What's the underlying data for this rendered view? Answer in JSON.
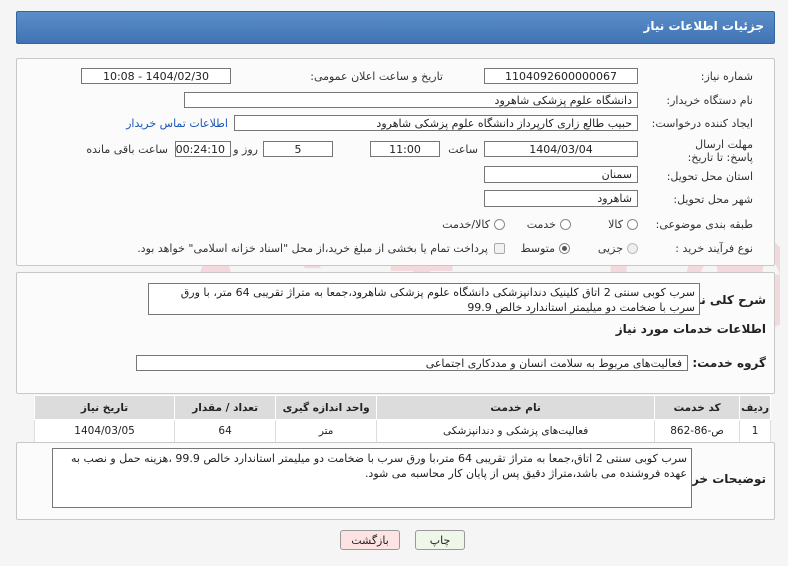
{
  "header": {
    "title": "جزئیات اطلاعات نیاز"
  },
  "form": {
    "need_number_label": "شماره نیاز:",
    "need_number": "1104092600000067",
    "announce_label": "تاریخ و ساعت اعلان عمومی:",
    "announce_value": "1404/02/30 - 10:08",
    "buyer_org_label": "نام دستگاه خریدار:",
    "buyer_org": "دانشگاه علوم پزشکی شاهرود",
    "requester_label": "ایجاد کننده درخواست:",
    "requester": "حبیب طالع زاری کارپرداز دانشگاه علوم پزشکی شاهرود",
    "contact_link": "اطلاعات تماس خریدار",
    "deadline_label": "مهلت ارسال پاسخ: تا تاریخ:",
    "deadline_date": "1404/03/04",
    "time_label": "ساعت",
    "deadline_time": "11:00",
    "days_value": "5",
    "days_label": "روز و",
    "remaining_time": "00:24:10",
    "remaining_label": "ساعت باقی مانده",
    "province_label": "استان محل تحویل:",
    "province": "سمنان",
    "city_label": "شهر محل تحویل:",
    "city": "شاهرود",
    "category_label": "طبقه بندی موضوعی:",
    "category_options": [
      "کالا",
      "خدمت",
      "کالا/خدمت"
    ],
    "process_label": "نوع فرآیند خرید :",
    "process_options": [
      "جزیی",
      "متوسط"
    ],
    "payment_note": "پرداخت تمام یا بخشی از مبلغ خرید،از محل \"اسناد خزانه اسلامی\" خواهد بود."
  },
  "description": {
    "label": "شرح کلی نیاز:",
    "text": "سرب کوبی سنتی 2 اتاق کلینیک دندانپزشکی دانشگاه علوم پزشکی شاهرود،جمعا به متراژ تقریبی 64 متر، با ورق سرب با ضخامت دو میلیمتر استاندارد خالص 99.9"
  },
  "services": {
    "section_title": "اطلاعات خدمات مورد نیاز",
    "group_label": "گروه خدمت:",
    "group_value": "فعالیت‌های مربوط به سلامت انسان و مددکاری اجتماعی",
    "columns": [
      "ردیف",
      "کد خدمت",
      "نام خدمت",
      "واحد اندازه گیری",
      "تعداد / مقدار",
      "تاریخ نیاز"
    ],
    "rows": [
      {
        "idx": "1",
        "code": "ص-86-862",
        "name": "فعالیت‌های پزشکی و دندانپزشکی",
        "unit": "متر",
        "qty": "64",
        "date": "1404/03/05"
      }
    ]
  },
  "buyer_notes": {
    "label": "توضیحات خریدار:",
    "text": "سرب کوبی سنتی 2 اتاق،جمعا به متراژ تقریبی 64 متر،با ورق سرب با ضخامت دو میلیمتر استاندارد خالص 99.9 ،هزینه حمل و نصب به عهده فروشنده می باشد،متراژ دقیق پس از پایان کار محاسبه می شود."
  },
  "buttons": {
    "print": "چاپ",
    "back": "بازگشت"
  },
  "watermark_text": "AriaTender.net"
}
